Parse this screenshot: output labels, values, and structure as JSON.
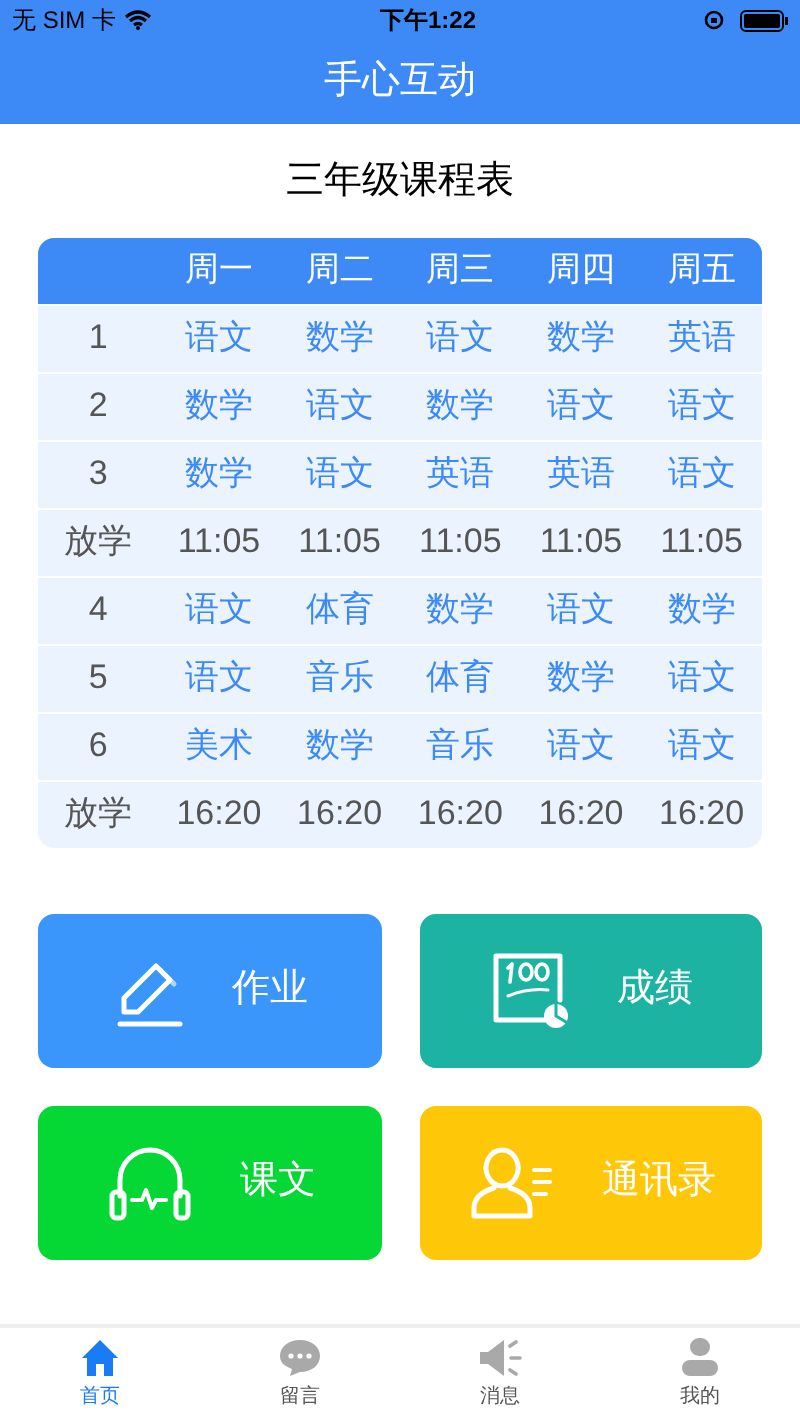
{
  "status_bar": {
    "carrier": "无 SIM 卡",
    "time": "下午1:22"
  },
  "nav_bar": {
    "title": "手心互动"
  },
  "schedule": {
    "title": "三年级课程表",
    "columns": [
      "周一",
      "周二",
      "周三",
      "周四",
      "周五"
    ],
    "rows": [
      {
        "kind": "lesson",
        "label": "1",
        "cells": [
          "语文",
          "数学",
          "语文",
          "数学",
          "英语"
        ]
      },
      {
        "kind": "lesson",
        "label": "2",
        "cells": [
          "数学",
          "语文",
          "数学",
          "语文",
          "语文"
        ]
      },
      {
        "kind": "lesson",
        "label": "3",
        "cells": [
          "数学",
          "语文",
          "英语",
          "英语",
          "语文"
        ]
      },
      {
        "kind": "dismissal",
        "label": "放学",
        "cells": [
          "11:05",
          "11:05",
          "11:05",
          "11:05",
          "11:05"
        ]
      },
      {
        "kind": "lesson",
        "label": "4",
        "cells": [
          "语文",
          "体育",
          "数学",
          "语文",
          "数学"
        ]
      },
      {
        "kind": "lesson",
        "label": "5",
        "cells": [
          "语文",
          "音乐",
          "体育",
          "数学",
          "语文"
        ]
      },
      {
        "kind": "lesson",
        "label": "6",
        "cells": [
          "美术",
          "数学",
          "音乐",
          "语文",
          "语文"
        ]
      },
      {
        "kind": "dismissal",
        "label": "放学",
        "cells": [
          "16:20",
          "16:20",
          "16:20",
          "16:20",
          "16:20"
        ]
      }
    ]
  },
  "tiles": [
    {
      "kind": "homework",
      "label": "作业",
      "color": "#3a96fb"
    },
    {
      "kind": "grades",
      "label": "成绩",
      "color": "#1db3a3"
    },
    {
      "kind": "lessons",
      "label": "课文",
      "color": "#05d834"
    },
    {
      "kind": "contacts",
      "label": "通讯录",
      "color": "#fec707"
    }
  ],
  "tab_bar": [
    {
      "kind": "home",
      "label": "首页",
      "selected": true
    },
    {
      "kind": "messages",
      "label": "留言",
      "selected": false
    },
    {
      "kind": "notices",
      "label": "消息",
      "selected": false
    },
    {
      "kind": "profile",
      "label": "我的",
      "selected": false
    }
  ]
}
